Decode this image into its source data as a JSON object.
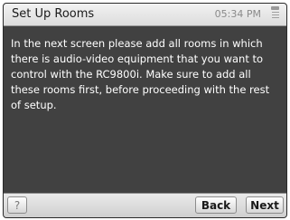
{
  "header": {
    "title": "Set Up Rooms",
    "time": "05:34 PM"
  },
  "icons": {
    "battery": "battery-icon"
  },
  "message": "In the next screen please add all rooms in which there is audio-video equipment that you want to control with the RC9800i. Make sure to add all these rooms first, before proceeding with the rest of setup.",
  "footer": {
    "help_label": "?",
    "back_label": "Back",
    "next_label": "Next"
  },
  "colors": {
    "background": "#414141",
    "bar": "#e0e0e0",
    "text": "#ffffff"
  }
}
